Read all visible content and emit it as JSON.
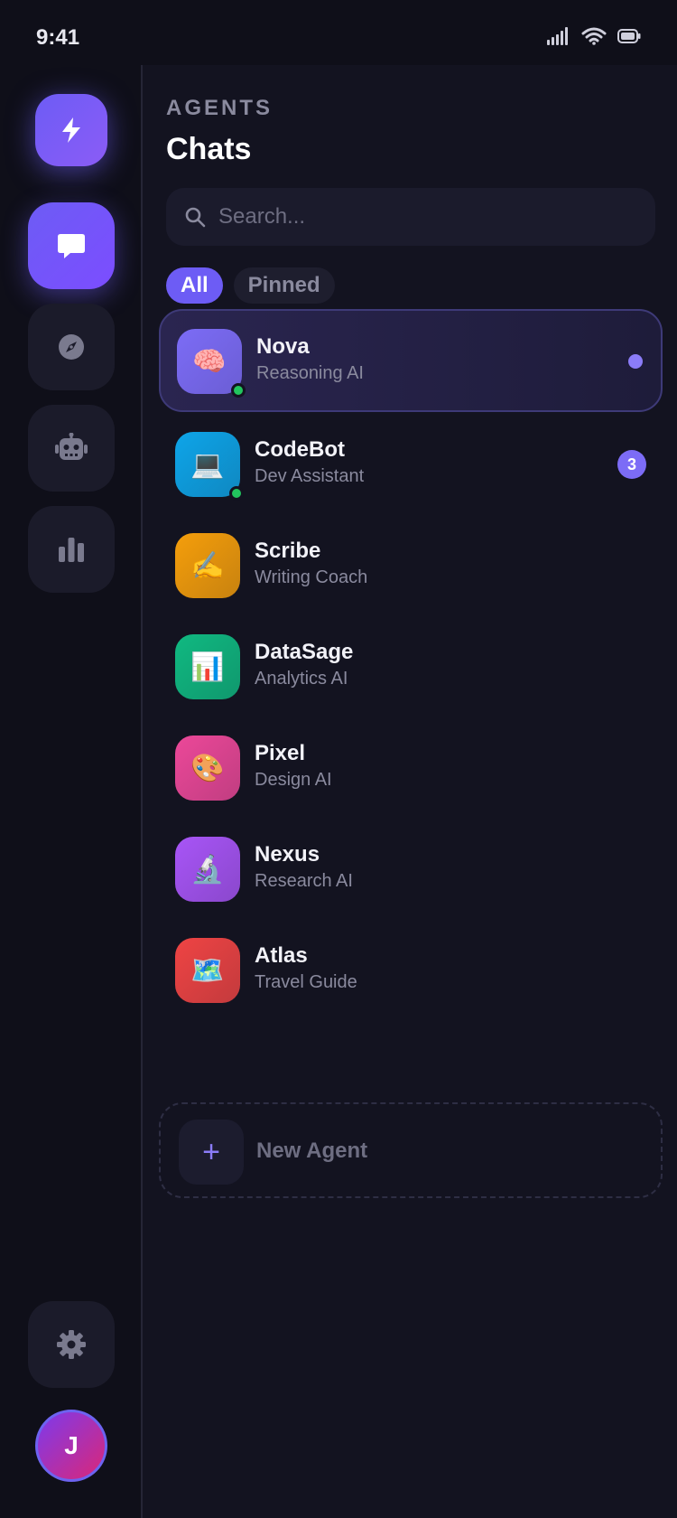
{
  "status_bar": {
    "time": "9:41"
  },
  "sidebar": {
    "items": [
      {
        "name": "chats",
        "icon": "message-icon",
        "active": true
      },
      {
        "name": "explore",
        "icon": "compass-icon",
        "active": false
      },
      {
        "name": "agents",
        "icon": "robot-icon",
        "active": false
      },
      {
        "name": "analytics",
        "icon": "bar-chart-icon",
        "active": false
      }
    ],
    "settings_icon": "gear-icon",
    "avatar_initial": "J"
  },
  "header": {
    "eyebrow": "AGENTS",
    "title": "Chats"
  },
  "search": {
    "placeholder": "Search..."
  },
  "filters": [
    {
      "label": "All",
      "active": true
    },
    {
      "label": "Pinned",
      "active": false
    }
  ],
  "agents": [
    {
      "name": "Nova",
      "description": "Reasoning AI",
      "emoji": "🧠",
      "color": "#7c6cf6",
      "online": true,
      "selected": true,
      "unread_dot": true,
      "badge": ""
    },
    {
      "name": "CodeBot",
      "description": "Dev Assistant",
      "emoji": "💻",
      "color": "#0ea5e9",
      "online": true,
      "selected": false,
      "unread_dot": false,
      "badge": "3"
    },
    {
      "name": "Scribe",
      "description": "Writing Coach",
      "emoji": "✍️",
      "color": "#f59e0b",
      "online": false,
      "selected": false,
      "unread_dot": false,
      "badge": ""
    },
    {
      "name": "DataSage",
      "description": "Analytics AI",
      "emoji": "📊",
      "color": "#10b981",
      "online": false,
      "selected": false,
      "unread_dot": false,
      "badge": ""
    },
    {
      "name": "Pixel",
      "description": "Design AI",
      "emoji": "🎨",
      "color": "#ec4899",
      "online": false,
      "selected": false,
      "unread_dot": false,
      "badge": ""
    },
    {
      "name": "Nexus",
      "description": "Research AI",
      "emoji": "🔬",
      "color": "#a855f7",
      "online": false,
      "selected": false,
      "unread_dot": false,
      "badge": ""
    },
    {
      "name": "Atlas",
      "description": "Travel Guide",
      "emoji": "🗺️",
      "color": "#ef4444",
      "online": false,
      "selected": false,
      "unread_dot": false,
      "badge": ""
    }
  ],
  "new_agent": {
    "label": "New Agent",
    "icon": "plus-icon"
  },
  "colors": {
    "accent": "#6d5cf5",
    "background": "#131320",
    "online": "#22c55e"
  }
}
